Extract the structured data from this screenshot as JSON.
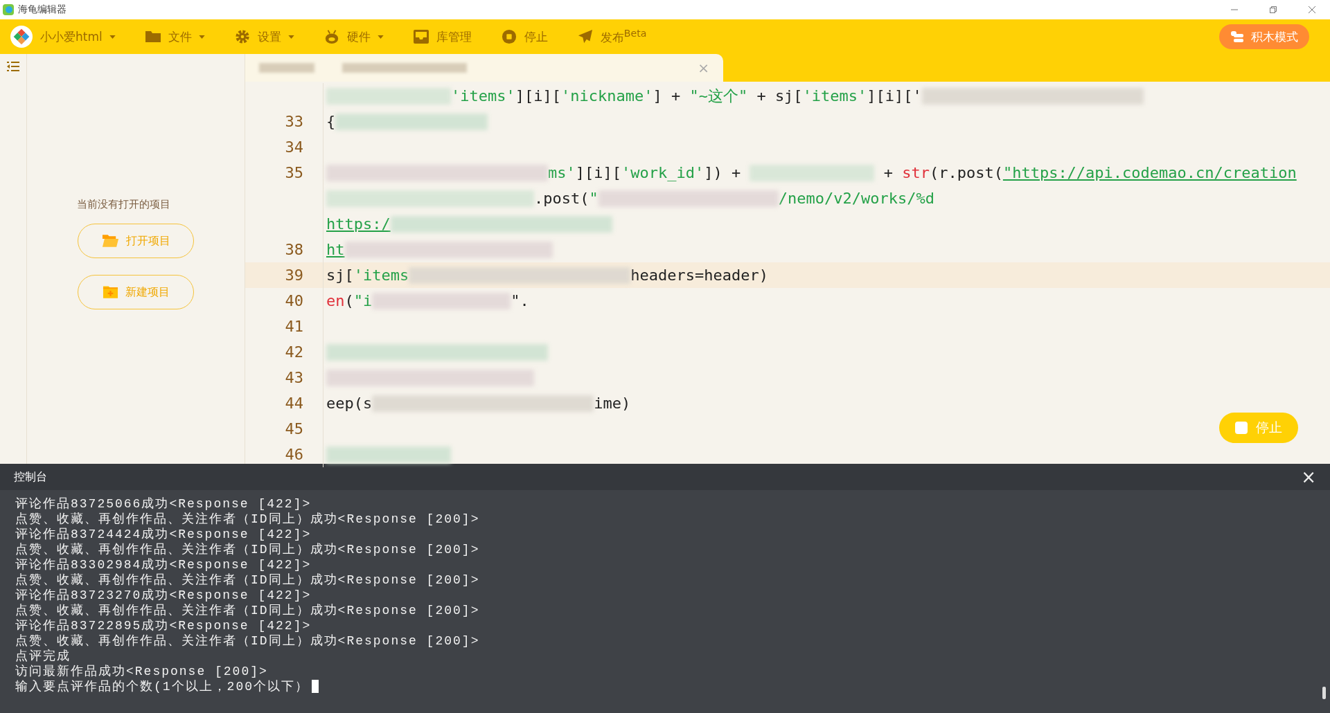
{
  "window": {
    "title": "海龟编辑器"
  },
  "toolbar": {
    "items": [
      {
        "kind": "logo",
        "label": "小小爱html",
        "dropdown": true
      },
      {
        "kind": "folder",
        "label": "文件",
        "dropdown": true
      },
      {
        "kind": "gear",
        "label": "设置",
        "dropdown": true
      },
      {
        "kind": "robot",
        "label": "硬件",
        "dropdown": true
      },
      {
        "kind": "box",
        "label": "库管理",
        "dropdown": false
      },
      {
        "kind": "stop",
        "label": "停止",
        "dropdown": false
      },
      {
        "kind": "send",
        "label": "发布$^{Beta}$",
        "dropdown": false
      }
    ],
    "mode_button": "积木模式"
  },
  "project_panel": {
    "message": "当前没有打开的项目",
    "buttons": [
      {
        "kind": "open",
        "label": "打开项目"
      },
      {
        "kind": "new",
        "label": "新建项目"
      }
    ]
  },
  "editor": {
    "tab_close": "×",
    "lines": [
      {
        "segments": [
          {
            "kind": "blur"
          },
          {
            "kind": "string",
            "text": "'items'"
          },
          {
            "kind": "plain",
            "text": "][i]["
          },
          {
            "kind": "string",
            "text": "'nickname'"
          },
          {
            "kind": "plain",
            "text": "] + "
          },
          {
            "kind": "string",
            "text": "\"~这个\""
          },
          {
            "kind": "plain",
            "text": " + sj["
          },
          {
            "kind": "string",
            "text": "'items'"
          },
          {
            "kind": "plain",
            "text": "][i]['"
          },
          {
            "kind": "blur"
          }
        ]
      },
      {
        "number": "33",
        "segments": [
          {
            "kind": "plain",
            "text": "{"
          },
          {
            "kind": "blur"
          }
        ]
      },
      {
        "number": "34"
      },
      {
        "number": "35",
        "segments": [
          {
            "kind": "blur"
          },
          {
            "kind": "string",
            "text": "ms'"
          },
          {
            "kind": "plain",
            "text": "][i]["
          },
          {
            "kind": "string",
            "text": "'work_id'"
          },
          {
            "kind": "plain",
            "text": "]) + "
          },
          {
            "kind": "blur"
          },
          {
            "kind": "plain",
            "text": " + "
          },
          {
            "kind": "keyword",
            "text": "str"
          },
          {
            "kind": "plain",
            "text": "(r.post("
          },
          {
            "kind": "link",
            "text": "\"https://api.codemao.cn/creation"
          }
        ]
      },
      {
        "segments": [
          {
            "kind": "blur"
          },
          {
            "kind": "plain",
            "text": ".post("
          },
          {
            "kind": "string",
            "text": "\""
          },
          {
            "kind": "blur"
          },
          {
            "kind": "string",
            "text": "/nemo/v2/works/%d"
          }
        ]
      },
      {
        "segments": [
          {
            "kind": "link",
            "text": "https:/"
          },
          {
            "kind": "blur"
          }
        ]
      },
      {
        "number": "38",
        "segments": [
          {
            "kind": "link",
            "text": "ht"
          },
          {
            "kind": "blur"
          }
        ]
      },
      {
        "number": "39",
        "segments": [
          {
            "kind": "plain",
            "text": "sj["
          },
          {
            "kind": "string",
            "text": "'items"
          },
          {
            "kind": "blur"
          },
          {
            "kind": "plain",
            "text": "headers=header)"
          }
        ]
      },
      {
        "number": "40",
        "segments": [
          {
            "kind": "keyword",
            "text": "en"
          },
          {
            "kind": "plain",
            "text": "("
          },
          {
            "kind": "string",
            "text": "\"i"
          },
          {
            "kind": "blur"
          },
          {
            "kind": "plain",
            "text": "\"."
          }
        ]
      },
      {
        "number": "41"
      },
      {
        "number": "42",
        "segments": [
          {
            "kind": "blur"
          }
        ]
      },
      {
        "number": "43",
        "segments": [
          {
            "kind": "blur"
          }
        ]
      },
      {
        "number": "44",
        "segments": [
          {
            "kind": "plain",
            "text": "eep(s"
          },
          {
            "kind": "blur"
          },
          {
            "kind": "plain",
            "text": "ime)"
          }
        ]
      },
      {
        "number": "45"
      },
      {
        "number": "46",
        "segments": [
          {
            "kind": "blur"
          }
        ]
      }
    ],
    "stop_button": "停止"
  },
  "console": {
    "title": "控制台",
    "close": "×",
    "lines": [
      "评论作品83725066成功<Response [422]>",
      "点赞、收藏、再创作作品、关注作者（ID同上）成功<Response [200]>",
      "评论作品83724424成功<Response [422]>",
      "点赞、收藏、再创作作品、关注作者（ID同上）成功<Response [200]>",
      "评论作品83302984成功<Response [422]>",
      "点赞、收藏、再创作作品、关注作者（ID同上）成功<Response [200]>",
      "评论作品83723270成功<Response [422]>",
      "点赞、收藏、再创作作品、关注作者（ID同上）成功<Response [200]>",
      "评论作品83722895成功<Response [422]>",
      "点赞、收藏、再创作作品、关注作者（ID同上）成功<Response [200]>",
      "点评完成",
      "访问最新作品成功<Response [200]>",
      "输入要点评作品的个数(1个以上，200个以下）"
    ]
  }
}
